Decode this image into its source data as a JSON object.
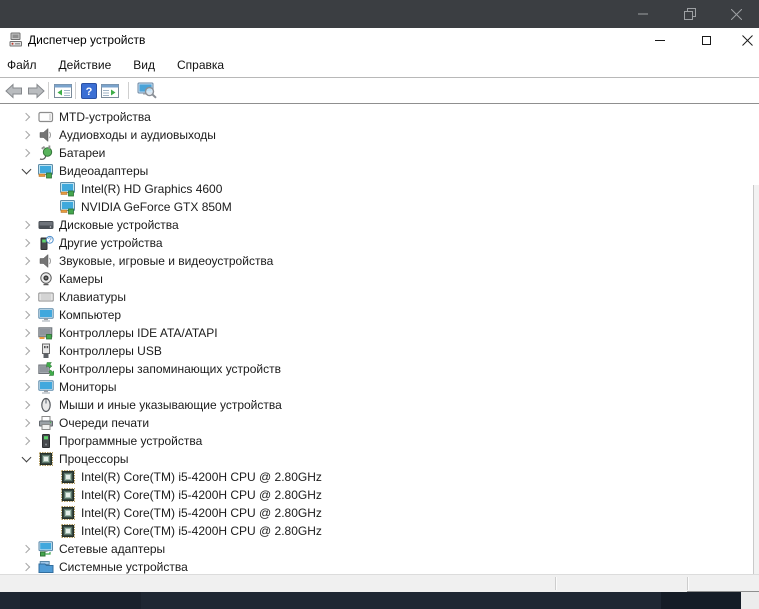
{
  "colors": {
    "background_titlebar": "#3b3e42",
    "taskbar_dark": "#1f2733",
    "taskbar_dark_alt": "#1a212c",
    "status_bar": "#f0f0f0",
    "window_bg": "#ffffff",
    "help_icon_blue": "#3b6fd4",
    "device_green": "#44a64d",
    "device_screen_blue": "#41a8dd"
  },
  "background": {
    "top_window_controls": {
      "icons": [
        "minimize-icon",
        "restore-icon",
        "close-icon"
      ]
    },
    "taskbar": {
      "segments": 4
    }
  },
  "device_manager": {
    "title": "Диспетчер устройств",
    "window_controls": {
      "icons": [
        "minimize-icon",
        "maximize-icon",
        "close-icon"
      ]
    },
    "menu": {
      "items": [
        {
          "label": "Файл"
        },
        {
          "label": "Действие"
        },
        {
          "label": "Вид"
        },
        {
          "label": "Справка"
        }
      ]
    },
    "toolbar": {
      "icons": [
        "back-icon",
        "forward-icon",
        "show-console-tree-icon",
        "help-icon",
        "properties-icon",
        "scan-hardware-changes-icon"
      ]
    },
    "tree": {
      "items": [
        {
          "label": "MTD-устройства",
          "level": 0,
          "state": "collapsed",
          "icon": "mtd-device-icon"
        },
        {
          "label": "Аудиовходы и аудиовыходы",
          "level": 0,
          "state": "collapsed",
          "icon": "audio-inputs-icon"
        },
        {
          "label": "Батареи",
          "level": 0,
          "state": "collapsed",
          "icon": "battery-icon"
        },
        {
          "label": "Видеоадаптеры",
          "level": 0,
          "state": "expanded",
          "icon": "display-adapter-icon"
        },
        {
          "label": "Intel(R) HD Graphics 4600",
          "level": 1,
          "state": "none",
          "icon": "display-adapter-icon"
        },
        {
          "label": "NVIDIA GeForce GTX 850M",
          "level": 1,
          "state": "none",
          "icon": "display-adapter-icon"
        },
        {
          "label": "Дисковые устройства",
          "level": 0,
          "state": "collapsed",
          "icon": "disk-drive-icon"
        },
        {
          "label": "Другие устройства",
          "level": 0,
          "state": "collapsed",
          "icon": "unknown-device-icon"
        },
        {
          "label": "Звуковые, игровые и видеоустройства",
          "level": 0,
          "state": "collapsed",
          "icon": "sound-device-icon"
        },
        {
          "label": "Камеры",
          "level": 0,
          "state": "collapsed",
          "icon": "camera-icon"
        },
        {
          "label": "Клавиатуры",
          "level": 0,
          "state": "collapsed",
          "icon": "keyboard-icon"
        },
        {
          "label": "Компьютер",
          "level": 0,
          "state": "collapsed",
          "icon": "computer-icon"
        },
        {
          "label": "Контроллеры IDE ATA/ATAPI",
          "level": 0,
          "state": "collapsed",
          "icon": "ide-controller-icon"
        },
        {
          "label": "Контроллеры USB",
          "level": 0,
          "state": "collapsed",
          "icon": "usb-controller-icon"
        },
        {
          "label": "Контроллеры запоминающих устройств",
          "level": 0,
          "state": "collapsed",
          "icon": "storage-controller-icon"
        },
        {
          "label": "Мониторы",
          "level": 0,
          "state": "collapsed",
          "icon": "monitor-icon"
        },
        {
          "label": "Мыши и иные указывающие устройства",
          "level": 0,
          "state": "collapsed",
          "icon": "mouse-icon"
        },
        {
          "label": "Очереди печати",
          "level": 0,
          "state": "collapsed",
          "icon": "print-queue-icon"
        },
        {
          "label": "Программные устройства",
          "level": 0,
          "state": "collapsed",
          "icon": "software-device-icon"
        },
        {
          "label": "Процессоры",
          "level": 0,
          "state": "expanded",
          "icon": "processor-icon"
        },
        {
          "label": "Intel(R) Core(TM) i5-4200H CPU @ 2.80GHz",
          "level": 1,
          "state": "none",
          "icon": "processor-icon"
        },
        {
          "label": "Intel(R) Core(TM) i5-4200H CPU @ 2.80GHz",
          "level": 1,
          "state": "none",
          "icon": "processor-icon"
        },
        {
          "label": "Intel(R) Core(TM) i5-4200H CPU @ 2.80GHz",
          "level": 1,
          "state": "none",
          "icon": "processor-icon"
        },
        {
          "label": "Intel(R) Core(TM) i5-4200H CPU @ 2.80GHz",
          "level": 1,
          "state": "none",
          "icon": "processor-icon"
        },
        {
          "label": "Сетевые адаптеры",
          "level": 0,
          "state": "collapsed",
          "icon": "network-adapter-icon"
        },
        {
          "label": "Системные устройства",
          "level": 0,
          "state": "collapsed",
          "icon": "system-device-icon"
        }
      ]
    },
    "status_bar": {
      "text": ""
    }
  }
}
